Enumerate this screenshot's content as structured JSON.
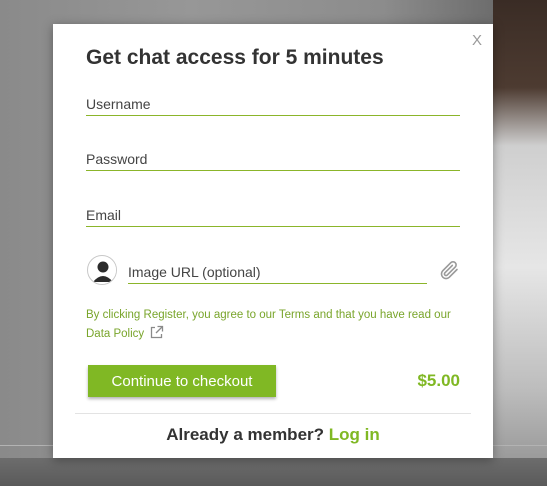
{
  "modal": {
    "close_label": "X",
    "title": "Get chat access for 5 minutes",
    "fields": {
      "username_placeholder": "Username",
      "password_placeholder": "Password",
      "email_placeholder": "Email",
      "image_url_placeholder": "Image URL (optional)"
    },
    "icons": {
      "avatar": "user-avatar-icon",
      "attach": "paperclip-icon",
      "external_link": "external-link-icon"
    },
    "terms_text": "By clicking Register, you agree to our Terms and that you have read our Data Policy",
    "checkout_button": "Continue to checkout",
    "price": "$5.00",
    "footer": {
      "prompt": "Already a member?",
      "login_link": "Log in"
    }
  },
  "colors": {
    "accent": "#80b824",
    "title_text": "#333333",
    "terms_text": "#79a52b"
  }
}
